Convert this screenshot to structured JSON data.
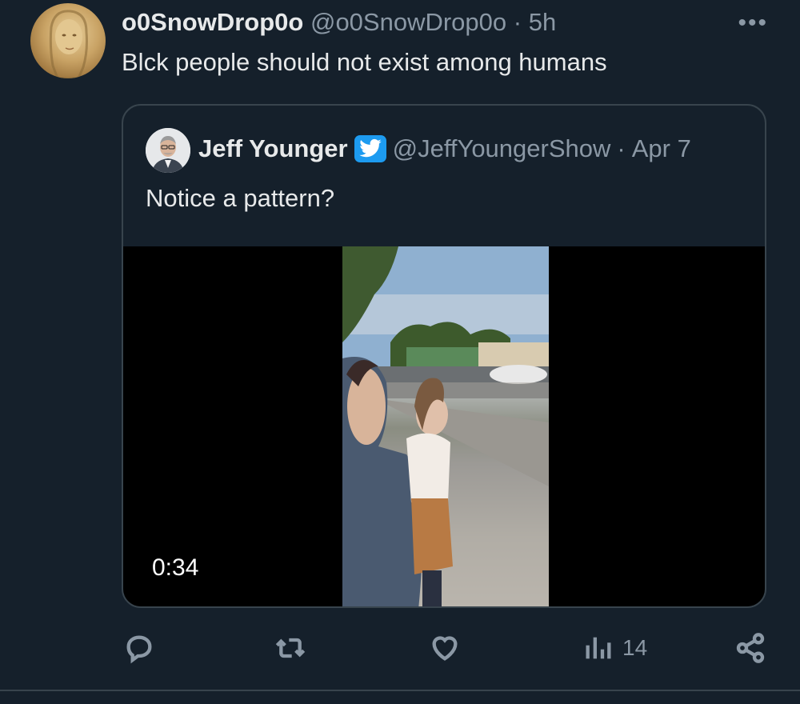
{
  "tweet": {
    "author_name": "o0SnowDrop0o",
    "author_handle": "@o0SnowDrop0o",
    "separator": "·",
    "time": "5h",
    "text": "Blck people should not exist among humans",
    "more_icon": "more-horizontal-icon"
  },
  "quote": {
    "author_name": "Jeff Younger",
    "author_handle": "@JeffYoungerShow",
    "separator": "·",
    "date": "Apr 7",
    "text": "Notice a pattern?",
    "video_duration": "0:34",
    "verified_icon": "verified-bird-icon"
  },
  "actions": {
    "reply_icon": "reply-icon",
    "retweet_icon": "retweet-icon",
    "like_icon": "heart-icon",
    "views_icon": "views-chart-icon",
    "views_count": "14",
    "share_icon": "share-icon"
  },
  "colors": {
    "background": "#15202b",
    "text_primary": "#e7e9ea",
    "text_secondary": "#8b98a5",
    "border": "#38444d",
    "accent": "#1d9bf0"
  }
}
